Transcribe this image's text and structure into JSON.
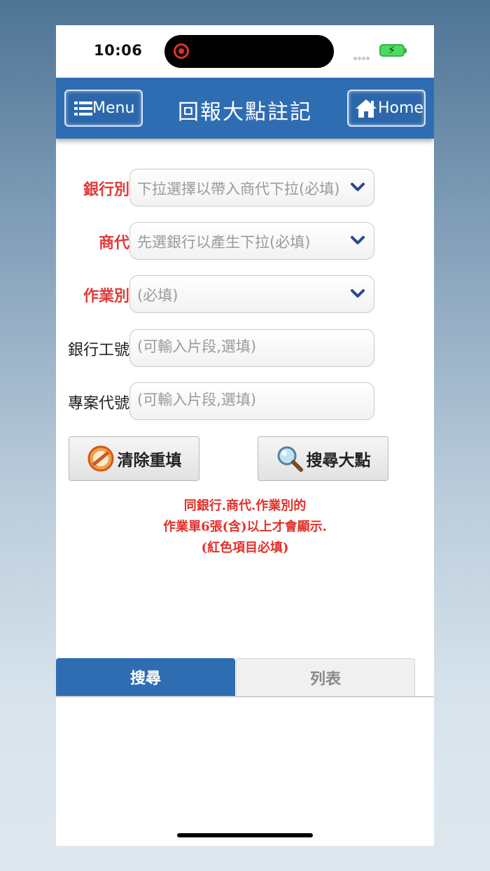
{
  "status_bar": {
    "time": "10:06"
  },
  "header": {
    "menu_label": "Menu",
    "title": "回報大點註記",
    "home_label": "Home"
  },
  "form": {
    "bank": {
      "label": "銀行別",
      "value": "下拉選擇以帶入商代下拉(必填)"
    },
    "merchant": {
      "label": "商代",
      "value": "先選銀行以產生下拉(必填)"
    },
    "job_type": {
      "label": "作業別",
      "value": "(必填)"
    },
    "bank_id": {
      "label": "銀行工號",
      "placeholder": "(可輸入片段,選填)"
    },
    "project_code": {
      "label": "專案代號",
      "placeholder": "(可輸入片段,選填)"
    }
  },
  "buttons": {
    "clear_label": "清除重填",
    "search_label": "搜尋大點"
  },
  "notice": {
    "line1": "同銀行.商代.作業別的",
    "line2": "作業單6張(含)以上才會顯示.",
    "line3": "(紅色項目必填)"
  },
  "tabs": [
    {
      "label": "搜尋",
      "active": true
    },
    {
      "label": "列表",
      "active": false
    }
  ],
  "colors": {
    "header_bg": "#2f6db3",
    "required_label": "#e03a3a",
    "notice_text": "#e0312b",
    "chevron": "#2a4a8c"
  }
}
